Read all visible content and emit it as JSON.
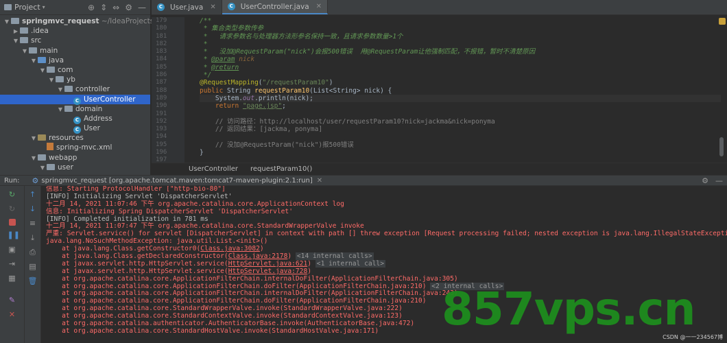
{
  "project": {
    "title": "Project",
    "tree": [
      {
        "label": "springmvc_request",
        "extra": "~/IdeaProjects/spr",
        "depth": 0,
        "kind": "module",
        "open": true
      },
      {
        "label": ".idea",
        "depth": 1,
        "kind": "folder",
        "open": false
      },
      {
        "label": "src",
        "depth": 1,
        "kind": "folder",
        "open": true
      },
      {
        "label": "main",
        "depth": 2,
        "kind": "folder",
        "open": true
      },
      {
        "label": "java",
        "depth": 3,
        "kind": "src",
        "open": true
      },
      {
        "label": "com",
        "depth": 4,
        "kind": "folder",
        "open": true
      },
      {
        "label": "yb",
        "depth": 5,
        "kind": "folder",
        "open": true
      },
      {
        "label": "controller",
        "depth": 6,
        "kind": "folder",
        "open": true
      },
      {
        "label": "UserController",
        "depth": 7,
        "kind": "class",
        "selected": true
      },
      {
        "label": "domain",
        "depth": 6,
        "kind": "folder",
        "open": true
      },
      {
        "label": "Address",
        "depth": 7,
        "kind": "class"
      },
      {
        "label": "User",
        "depth": 7,
        "kind": "class"
      },
      {
        "label": "resources",
        "depth": 3,
        "kind": "res",
        "open": true
      },
      {
        "label": "spring-mvc.xml",
        "depth": 4,
        "kind": "xml"
      },
      {
        "label": "webapp",
        "depth": 3,
        "kind": "folder",
        "open": true
      },
      {
        "label": "user",
        "depth": 4,
        "kind": "folder",
        "open": true
      }
    ]
  },
  "tabs": [
    {
      "label": "User.java",
      "active": false
    },
    {
      "label": "UserController.java",
      "active": true
    }
  ],
  "editor": {
    "line_numbers": [
      "179",
      "180",
      "181",
      "182",
      "183",
      "184",
      "185",
      "186",
      "187",
      "188",
      "189",
      "190",
      "191",
      "192",
      "193",
      "194",
      "195",
      "196",
      "197"
    ],
    "breadcrumb": [
      "UserController",
      "requestParam10()"
    ]
  },
  "run": {
    "label": "Run:",
    "config": "springmvc_request [org.apache.tomcat.maven:tomcat7-maven-plugin:2.1:run]"
  },
  "console": [
    {
      "c": "red",
      "t": "信息: Starting ProtocolHandler [\"http-bio-80\"]"
    },
    {
      "c": "white",
      "t": "[INFO] Initializing Servlet 'DispatcherServlet'"
    },
    {
      "c": "red",
      "t": "十二月 14, 2021 11:07:46 下午 org.apache.catalina.core.ApplicationContext log"
    },
    {
      "c": "red",
      "t": "信息: Initializing Spring DispatcherServlet 'DispatcherServlet'"
    },
    {
      "c": "white",
      "t": "[INFO] Completed initialization in 781 ms"
    },
    {
      "c": "red",
      "t": "十二月 14, 2021 11:07:47 下午 org.apache.catalina.core.StandardWrapperValve invoke"
    },
    {
      "c": "red",
      "t": "严重: Servlet.service() for servlet [DispatcherServlet] in context with path [] threw exception [Request processing failed; nested exception is java.lang.IllegalStateException: No primary or"
    },
    {
      "c": "red",
      "t": "java.lang.NoSuchMethodException: java.util.List.<init>()"
    },
    {
      "c": "red",
      "t": "    at java.lang.Class.getConstructor0(",
      "link": "Class.java:3082",
      "tail": ")"
    },
    {
      "c": "red",
      "t": "    at java.lang.Class.getDeclaredConstructor(",
      "link": "Class.java:2178",
      "tail": ")",
      "fold": "<14 internal calls>"
    },
    {
      "c": "red",
      "t": "    at javax.servlet.http.HttpServlet.service(",
      "link": "HttpServlet.java:621",
      "tail": ")",
      "fold": "<1 internal call>"
    },
    {
      "c": "red",
      "t": "    at javax.servlet.http.HttpServlet.service(",
      "link": "HttpServlet.java:728",
      "tail": ")"
    },
    {
      "c": "red",
      "t": "    at org.apache.catalina.core.ApplicationFilterChain.internalDoFilter(ApplicationFilterChain.java:305)"
    },
    {
      "c": "red",
      "t": "    at org.apache.catalina.core.ApplicationFilterChain.doFilter(ApplicationFilterChain.java:210)",
      "fold": "<2 internal calls>"
    },
    {
      "c": "red",
      "t": "    at org.apache.catalina.core.ApplicationFilterChain.internalDoFilter(ApplicationFilterChain.java:243)"
    },
    {
      "c": "red",
      "t": "    at org.apache.catalina.core.ApplicationFilterChain.doFilter(ApplicationFilterChain.java:210)"
    },
    {
      "c": "red",
      "t": "    at org.apache.catalina.core.StandardWrapperValve.invoke(StandardWrapperValve.java:222)"
    },
    {
      "c": "red",
      "t": "    at org.apache.catalina.core.StandardContextValve.invoke(StandardContextValve.java:123)"
    },
    {
      "c": "red",
      "t": "    at org.apache.catalina.authenticator.AuthenticatorBase.invoke(AuthenticatorBase.java:472)"
    },
    {
      "c": "red",
      "t": "    at org.apache.catalina.core.StandardHostValve.invoke(StandardHostValve.java:171)"
    }
  ],
  "watermark": "857vps.cn",
  "credit": "CSDN @一一234567博"
}
